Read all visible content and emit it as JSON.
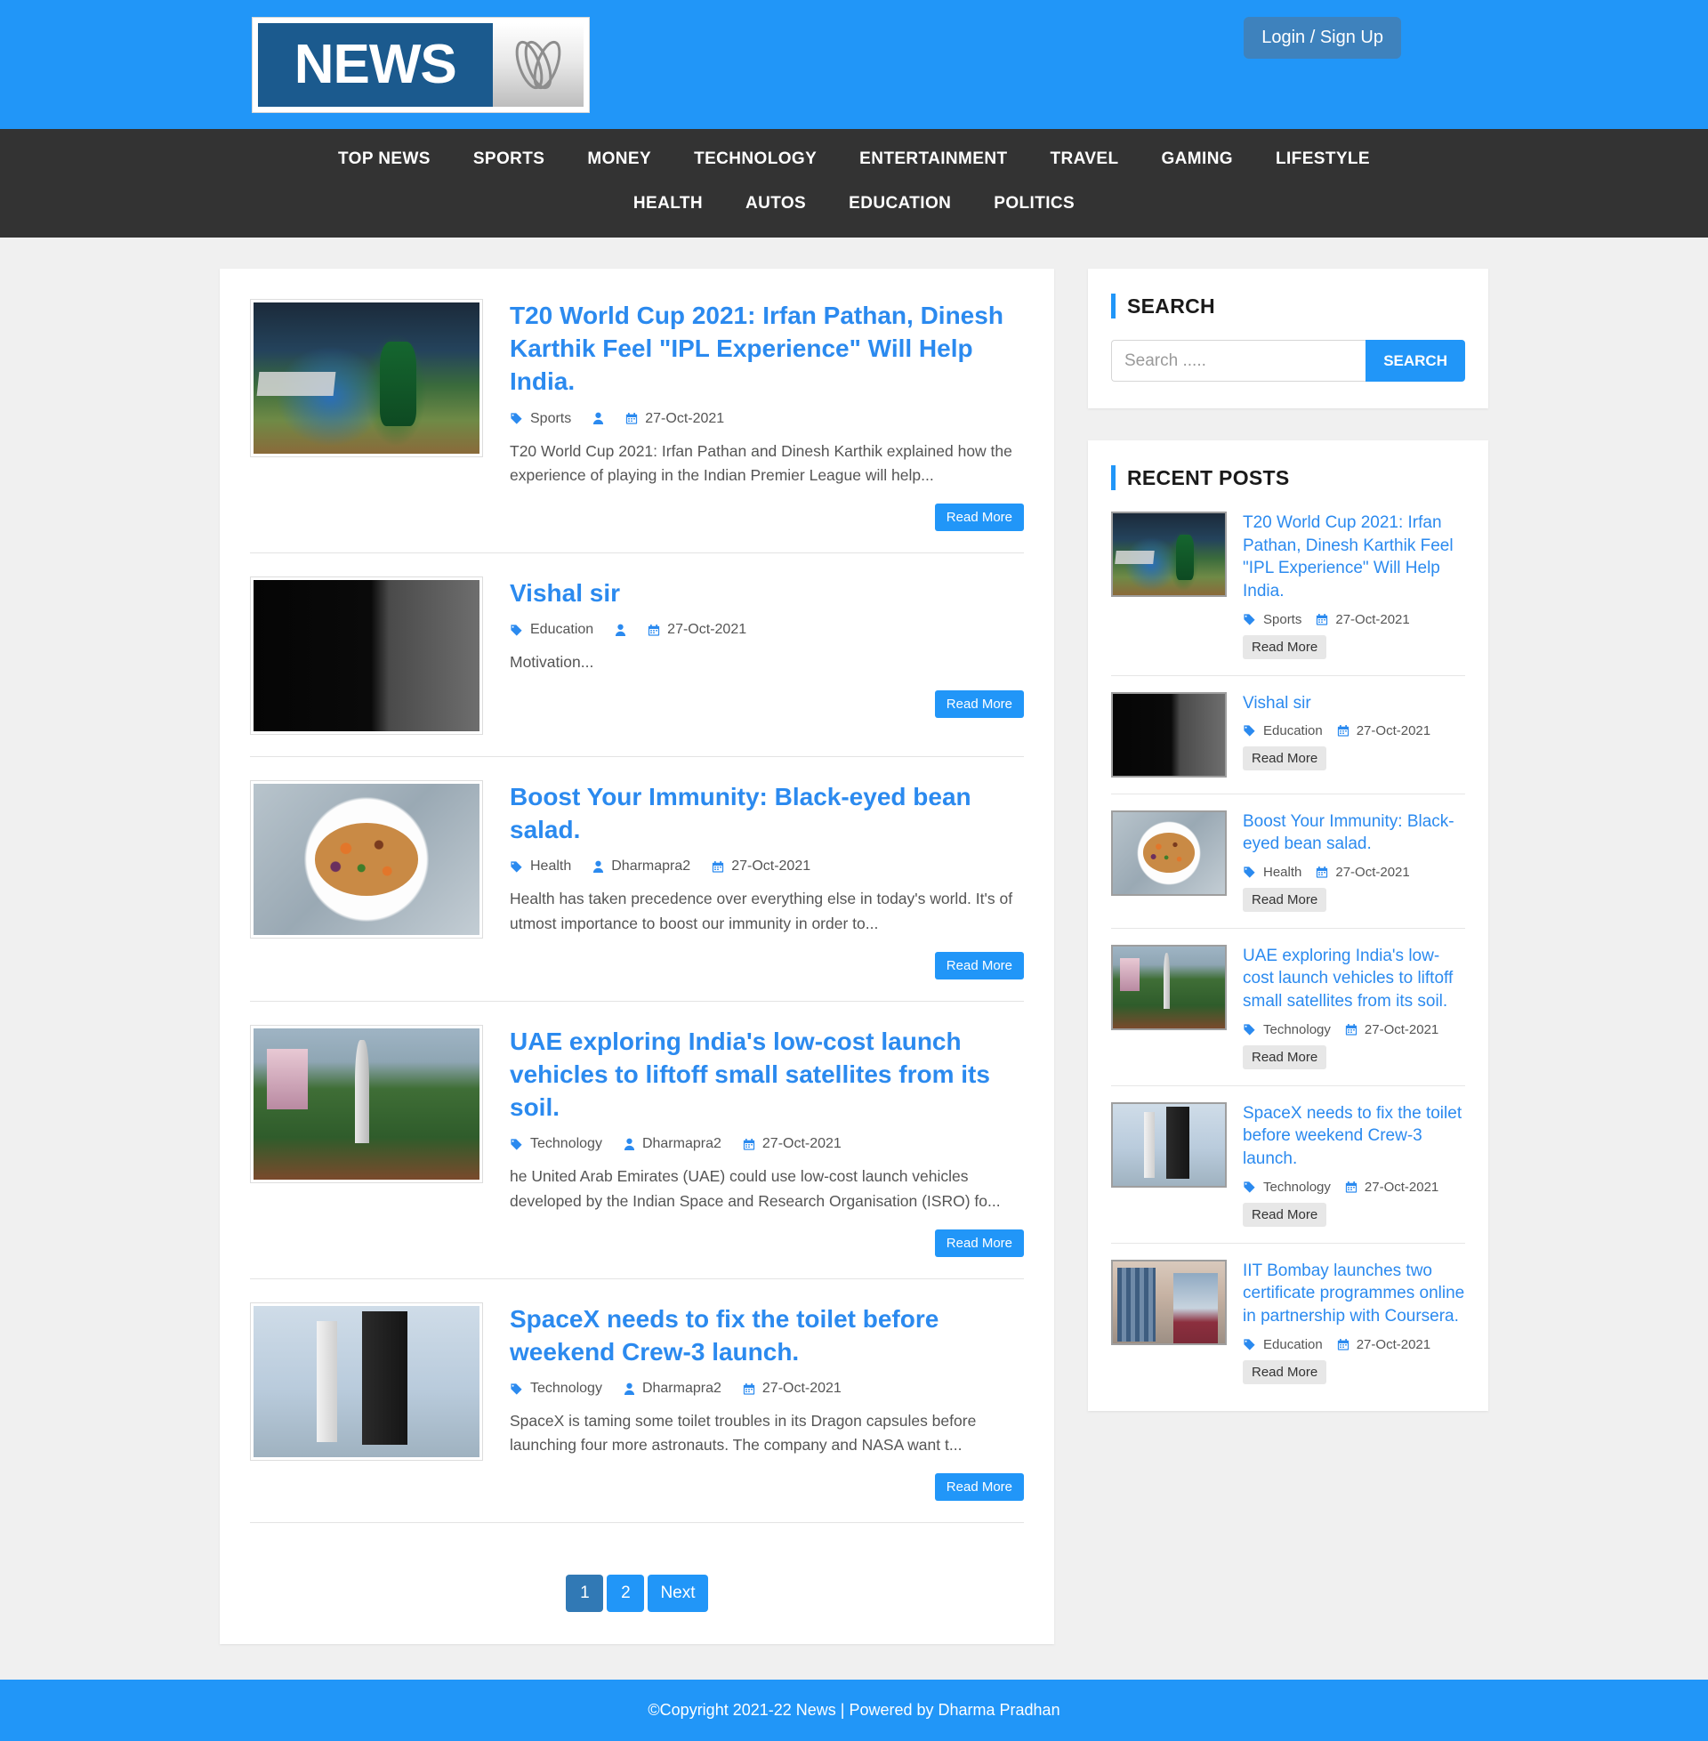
{
  "header": {
    "logo_text": "NEWS",
    "logo_mark": "abc-swirl-logo",
    "login_label": "Login / Sign Up"
  },
  "nav": {
    "items": [
      {
        "label": "TOP NEWS"
      },
      {
        "label": "SPORTS"
      },
      {
        "label": "MONEY"
      },
      {
        "label": "TECHNOLOGY"
      },
      {
        "label": "ENTERTAINMENT"
      },
      {
        "label": "TRAVEL"
      },
      {
        "label": "GAMING"
      },
      {
        "label": "LIFESTYLE"
      },
      {
        "label": "HEALTH"
      },
      {
        "label": "AUTOS"
      },
      {
        "label": "EDUCATION"
      },
      {
        "label": "POLITICS"
      }
    ]
  },
  "articles": [
    {
      "title": "T20 World Cup 2021: Irfan Pathan, Dinesh Karthik Feel \"IPL Experience\" Will Help India.",
      "category": "Sports",
      "author": "",
      "date": "27-Oct-2021",
      "excerpt": "T20 World Cup 2021: Irfan Pathan and Dinesh Karthik explained how the experience of playing in the Indian Premier League will help...",
      "read_more": "Read More",
      "image": "cricket-match-photo"
    },
    {
      "title": "Vishal sir",
      "category": "Education",
      "author": "",
      "date": "27-Oct-2021",
      "excerpt": "Motivation...",
      "read_more": "Read More",
      "image": "motivational-quote-photo"
    },
    {
      "title": "Boost Your Immunity: Black-eyed bean salad.",
      "category": "Health",
      "author": "Dharmapra2",
      "date": "27-Oct-2021",
      "excerpt": "Health has taken precedence over everything else in today's world. It's of utmost importance to boost our immunity in order to...",
      "read_more": "Read More",
      "image": "bean-salad-photo"
    },
    {
      "title": "UAE exploring India's low-cost launch vehicles to liftoff small satellites from its soil.",
      "category": "Technology",
      "author": "Dharmapra2",
      "date": "27-Oct-2021",
      "excerpt": "he United Arab Emirates (UAE) could use low-cost launch vehicles developed by the Indian Space and Research Organisation (ISRO) fo...",
      "read_more": "Read More",
      "image": "isro-launch-pad-photo"
    },
    {
      "title": "SpaceX needs to fix the toilet before weekend Crew-3 launch.",
      "category": "Technology",
      "author": "Dharmapra2",
      "date": "27-Oct-2021",
      "excerpt": "SpaceX is taming some toilet troubles in its Dragon capsules before launching four more astronauts. The company and NASA want t...",
      "read_more": "Read More",
      "image": "spacex-rocket-photo"
    }
  ],
  "pagination": {
    "pages": [
      {
        "label": "1",
        "active": true
      },
      {
        "label": "2",
        "active": false
      }
    ],
    "next_label": "Next"
  },
  "search": {
    "heading": "SEARCH",
    "placeholder": "Search .....",
    "value": "",
    "button_label": "SEARCH"
  },
  "recent_posts": {
    "heading": "RECENT POSTS",
    "items": [
      {
        "title": "T20 World Cup 2021: Irfan Pathan, Dinesh Karthik Feel \"IPL Experience\" Will Help India.",
        "category": "Sports",
        "date": "27-Oct-2021",
        "read_more": "Read More",
        "image": "cricket-match-photo"
      },
      {
        "title": "Vishal sir",
        "category": "Education",
        "date": "27-Oct-2021",
        "read_more": "Read More",
        "image": "motivational-quote-photo"
      },
      {
        "title": "Boost Your Immunity: Black-eyed bean salad.",
        "category": "Health",
        "date": "27-Oct-2021",
        "read_more": "Read More",
        "image": "bean-salad-photo"
      },
      {
        "title": "UAE exploring India's low-cost launch vehicles to liftoff small satellites from its soil.",
        "category": "Technology",
        "date": "27-Oct-2021",
        "read_more": "Read More",
        "image": "isro-launch-pad-photo"
      },
      {
        "title": "SpaceX needs to fix the toilet before weekend Crew-3 launch.",
        "category": "Technology",
        "date": "27-Oct-2021",
        "read_more": "Read More",
        "image": "spacex-rocket-photo"
      },
      {
        "title": "IIT Bombay launches two certificate programmes online in partnership with Coursera.",
        "category": "Education",
        "date": "27-Oct-2021",
        "read_more": "Read More",
        "image": "students-laptop-photo"
      }
    ]
  },
  "footer": {
    "text": "©Copyright 2021-22 News | Powered by Dharma Pradhan"
  },
  "colors": {
    "brand_blue": "#2196f8",
    "nav_dark": "#333333",
    "link_blue": "#2b8aef",
    "page_bg": "#f0f0f0",
    "login_blue": "#3e82bd"
  }
}
